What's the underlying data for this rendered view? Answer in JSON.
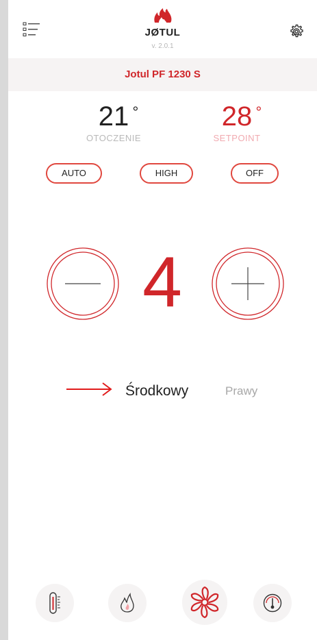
{
  "header": {
    "brand": "JØTUL",
    "version": "v. 2.0.1"
  },
  "device": {
    "model": "Jotul PF 1230 S"
  },
  "temperatures": {
    "ambient_value": "21",
    "ambient_label": "OTOCZENIE",
    "setpoint_value": "28",
    "setpoint_label": "SETPOINT",
    "degree_symbol": "°"
  },
  "modes": {
    "auto_label": "AUTO",
    "high_label": "HIGH",
    "off_label": "OFF"
  },
  "power": {
    "value": "4"
  },
  "fan_selector": {
    "selected_label": "Środkowy",
    "other_label": "Prawy"
  },
  "bottom_nav": {
    "items": [
      "thermometer-icon",
      "flame-icon",
      "fan-icon",
      "gauge-icon"
    ],
    "active": "fan-icon"
  },
  "colors": {
    "accent": "#d0262a",
    "mode_border": "#e0473e",
    "setpoint_label": "#f1aab0",
    "muted_label": "#b9b9b9",
    "model_bar_bg": "#f6f3f3"
  }
}
